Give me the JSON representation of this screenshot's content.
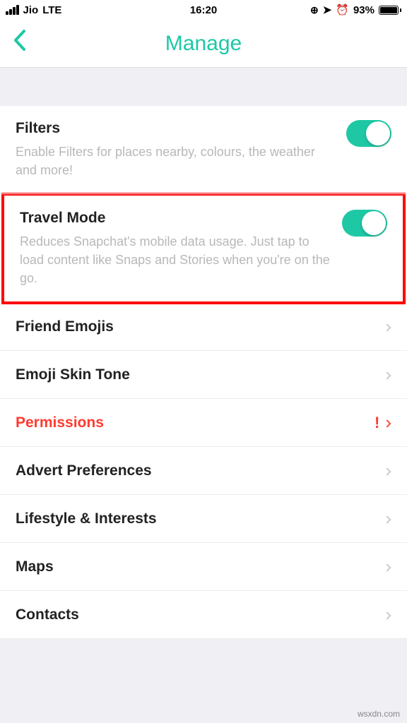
{
  "statusBar": {
    "carrier": "Jio",
    "network": "LTE",
    "time": "16:20",
    "batteryPct": "93%"
  },
  "nav": {
    "title": "Manage"
  },
  "items": {
    "filters": {
      "title": "Filters",
      "desc": "Enable Filters for places nearby, colours, the weather and more!"
    },
    "travelMode": {
      "title": "Travel Mode",
      "desc": "Reduces Snapchat's mobile data usage. Just tap to load content like Snaps and Stories when you're on the go."
    },
    "friendEmojis": {
      "title": "Friend Emojis"
    },
    "emojiSkinTone": {
      "title": "Emoji Skin Tone"
    },
    "permissions": {
      "title": "Permissions"
    },
    "advertPrefs": {
      "title": "Advert Preferences"
    },
    "lifestyle": {
      "title": "Lifestyle & Interests"
    },
    "maps": {
      "title": "Maps"
    },
    "contacts": {
      "title": "Contacts"
    }
  },
  "watermark": "wsxdn.com"
}
